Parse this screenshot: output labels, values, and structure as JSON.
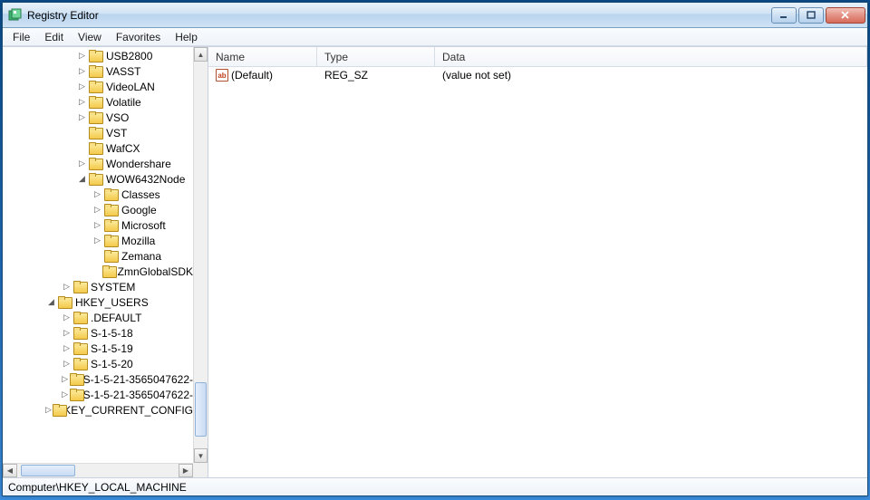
{
  "window": {
    "title": "Registry Editor"
  },
  "menu": {
    "file": "File",
    "edit": "Edit",
    "view": "View",
    "favorites": "Favorites",
    "help": "Help"
  },
  "tree": {
    "usb2800": "USB2800",
    "vasst": "VASST",
    "videolan": "VideoLAN",
    "volatile": "Volatile",
    "vso": "VSO",
    "vst": "VST",
    "wafcx": "WafCX",
    "wondershare": "Wondershare",
    "wow6432": "WOW6432Node",
    "classes": "Classes",
    "google": "Google",
    "microsoft": "Microsoft",
    "mozilla": "Mozilla",
    "zemana": "Zemana",
    "zmnglobalsdk": "ZmnGlobalSDK",
    "system": "SYSTEM",
    "hkey_users": "HKEY_USERS",
    "default": ".DEFAULT",
    "s1518": "S-1-5-18",
    "s1519": "S-1-5-19",
    "s1520": "S-1-5-20",
    "s1521a": "S-1-5-21-3565047622-",
    "s1521b": "S-1-5-21-3565047622-",
    "hkey_current_config": "HKEY_CURRENT_CONFIG"
  },
  "columns": {
    "name": "Name",
    "type": "Type",
    "data": "Data"
  },
  "row": {
    "name": "(Default)",
    "type": "REG_SZ",
    "data": "(value not set)"
  },
  "statusbar": "Computer\\HKEY_LOCAL_MACHINE"
}
